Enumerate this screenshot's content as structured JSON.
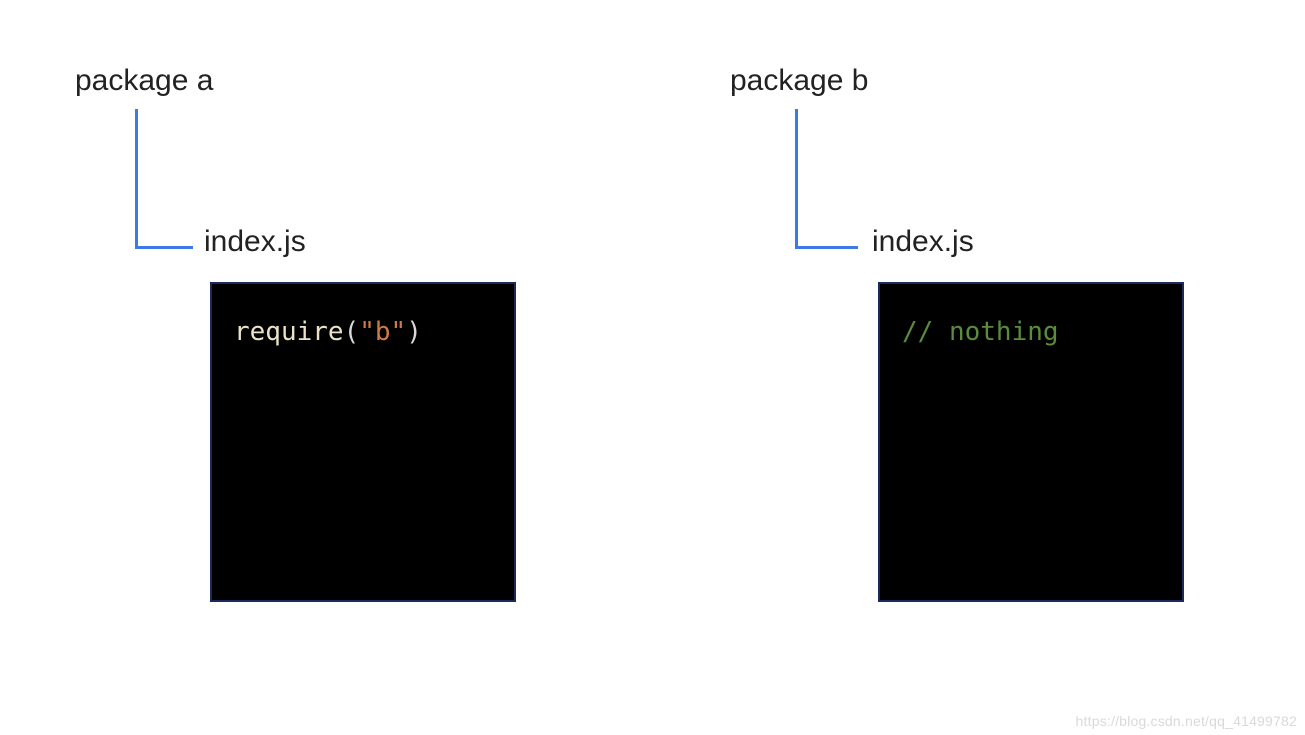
{
  "packages": [
    {
      "title": "package a",
      "file": "index.js",
      "code": {
        "segments": [
          {
            "text": "require",
            "class": "code-fn"
          },
          {
            "text": "(",
            "class": "code-paren"
          },
          {
            "text": "\"b\"",
            "class": "code-str"
          },
          {
            "text": ")",
            "class": "code-paren"
          }
        ]
      }
    },
    {
      "title": "package b",
      "file": "index.js",
      "code": {
        "segments": [
          {
            "text": "// nothing",
            "class": "code-comment"
          }
        ]
      }
    }
  ],
  "watermark": "https://blog.csdn.net/qq_41499782",
  "colors": {
    "connector": "#3d7ae5",
    "code_bg": "#000000",
    "code_border": "#1b2a5c"
  }
}
